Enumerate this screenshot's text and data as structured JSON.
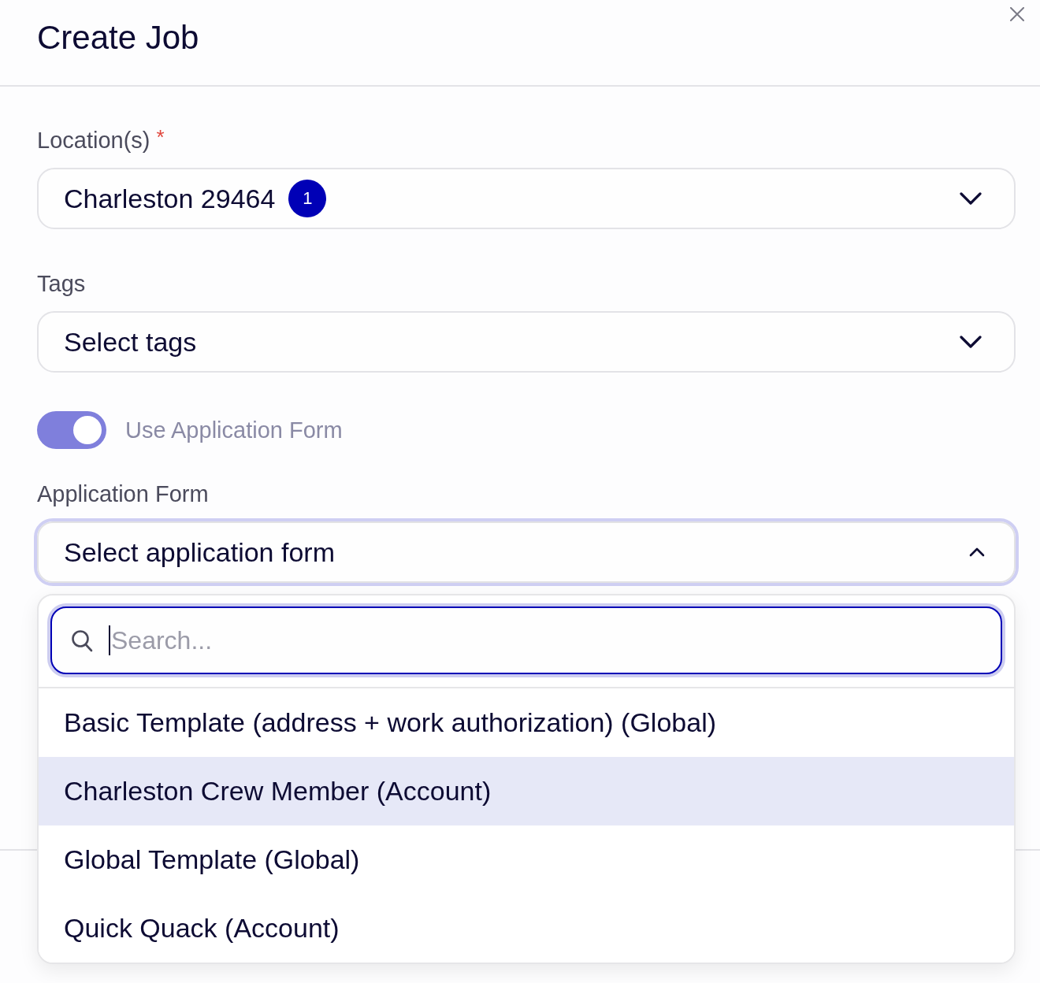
{
  "dialog": {
    "title": "Create Job"
  },
  "fields": [
    {
      "label": "Location(s)",
      "required_mark": "*",
      "value": "Charleston 29464",
      "count": "1",
      "expanded": false
    },
    {
      "label": "Tags",
      "placeholder": "Select tags",
      "expanded": false
    }
  ],
  "toggle": {
    "label": "Use Application Form",
    "on": true
  },
  "application_form": {
    "label": "Application Form",
    "placeholder": "Select application form",
    "expanded": true,
    "search": {
      "placeholder": "Search...",
      "focused": true
    },
    "options": [
      {
        "label": "Basic Template (address + work authorization) (Global)",
        "highlighted": false
      },
      {
        "label": "Charleston Crew Member (Account)",
        "highlighted": true
      },
      {
        "label": "Global Template (Global)",
        "highlighted": false
      },
      {
        "label": "Quick Quack (Account)",
        "highlighted": false
      }
    ]
  }
}
